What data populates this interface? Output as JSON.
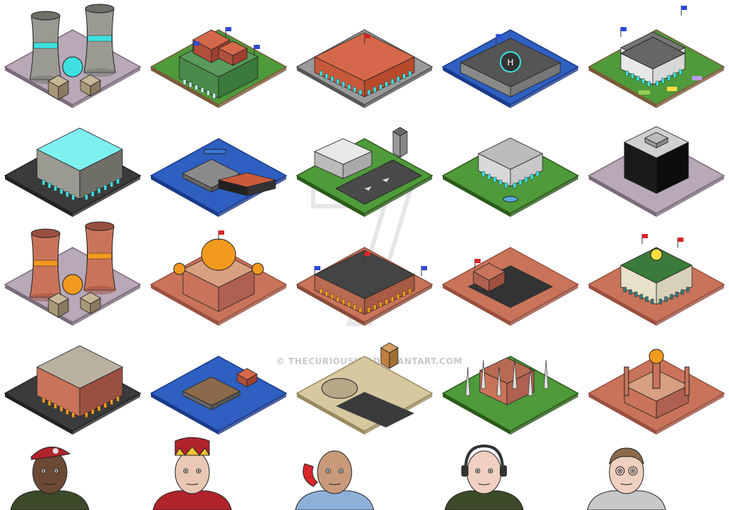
{
  "watermark": {
    "text": "© THECURIOUSKIT.DEVIANTART.COM"
  },
  "palette": {
    "concrete": "#9a9a92",
    "concrete_dark": "#6f6f68",
    "brick": "#c9745a",
    "brick_dark": "#9a5040",
    "roof_red": "#d5684a",
    "grass": "#4f9a3a",
    "water": "#2f5fc0",
    "accent_cyan": "#3fe0e0",
    "accent_orange": "#f29a1e",
    "asphalt": "#3b3b3b",
    "flag_blue": "#2a4bd8",
    "flag_red": "#d8262a"
  },
  "buildings": [
    {
      "name": "cooling-towers-modern",
      "kind": "towers",
      "style": "concrete"
    },
    {
      "name": "palace-green",
      "kind": "palace",
      "style": "green"
    },
    {
      "name": "barracks-red-roof",
      "kind": "flatroof",
      "style": "red"
    },
    {
      "name": "fortress-helipad",
      "kind": "fort",
      "style": "stone"
    },
    {
      "name": "embassy-white",
      "kind": "embassy",
      "style": "white"
    },
    {
      "name": "factory-modern",
      "kind": "factory",
      "style": "concrete"
    },
    {
      "name": "shipyard-modern",
      "kind": "port",
      "style": "blue"
    },
    {
      "name": "airport-modern",
      "kind": "airport",
      "style": "concrete"
    },
    {
      "name": "ministry-modern",
      "kind": "ministry",
      "style": "concrete"
    },
    {
      "name": "office-tower-black",
      "kind": "office",
      "style": "black"
    },
    {
      "name": "cooling-towers-brick",
      "kind": "towers",
      "style": "brick"
    },
    {
      "name": "domed-palace",
      "kind": "domed",
      "style": "brick"
    },
    {
      "name": "barracks-brick",
      "kind": "flatroof",
      "style": "brick"
    },
    {
      "name": "military-base",
      "kind": "base",
      "style": "brick"
    },
    {
      "name": "palace-clock",
      "kind": "clockpalace",
      "style": "brick"
    },
    {
      "name": "factory-brick",
      "kind": "factory",
      "style": "brick"
    },
    {
      "name": "shipyard-old",
      "kind": "port",
      "style": "brick"
    },
    {
      "name": "airfield-hangars",
      "kind": "airfield",
      "style": "sand"
    },
    {
      "name": "cathedral",
      "kind": "cathedral",
      "style": "brick"
    },
    {
      "name": "mosque",
      "kind": "mosque",
      "style": "brick"
    }
  ],
  "portraits": [
    {
      "name": "soldier-red-beret",
      "skin": "#6b4a35",
      "hat": "#b0232a",
      "clothes": "#3c4a2a"
    },
    {
      "name": "king-crown",
      "skin": "#e8c8b4",
      "hat": "#b0232a",
      "clothes": "#b0232a"
    },
    {
      "name": "man-phone",
      "skin": "#c89a7a",
      "hat": "#c89a7a",
      "clothes": "#8db0d8"
    },
    {
      "name": "operator-headset",
      "skin": "#f0d0c0",
      "hat": "#d8c8a0",
      "clothes": "#3c4a2a"
    },
    {
      "name": "woman-glasses",
      "skin": "#f0d0c0",
      "hat": "#8a6a4a",
      "clothes": "#c8c8c8"
    }
  ]
}
